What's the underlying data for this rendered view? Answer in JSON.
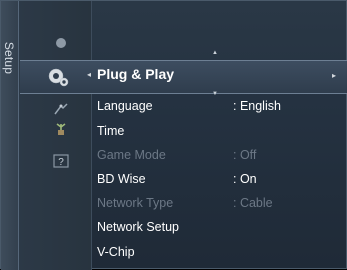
{
  "side_tab": {
    "label": "Setup"
  },
  "selected": {
    "label": "Plug & Play"
  },
  "menu_items": [
    {
      "label": "Language",
      "value": ": English",
      "enabled": true
    },
    {
      "label": "Time",
      "value": "",
      "enabled": true
    },
    {
      "label": "Game Mode",
      "value": ": Off",
      "enabled": false
    },
    {
      "label": "BD Wise",
      "value": ": On",
      "enabled": true
    },
    {
      "label": "Network Type",
      "value": ": Cable",
      "enabled": false
    },
    {
      "label": "Network Setup",
      "value": "",
      "enabled": true
    },
    {
      "label": "V-Chip",
      "value": "",
      "enabled": true
    }
  ],
  "colors": {
    "background": "#243140",
    "highlight": "#3d4d60",
    "text": "#ffffff",
    "disabled_text": "#6c7886"
  },
  "icons": [
    "setup-gear-icon",
    "arrow-left-icon",
    "arrow-right-icon",
    "arrow-up-icon",
    "arrow-down-icon",
    "antenna-icon",
    "plant-icon",
    "help-icon"
  ]
}
